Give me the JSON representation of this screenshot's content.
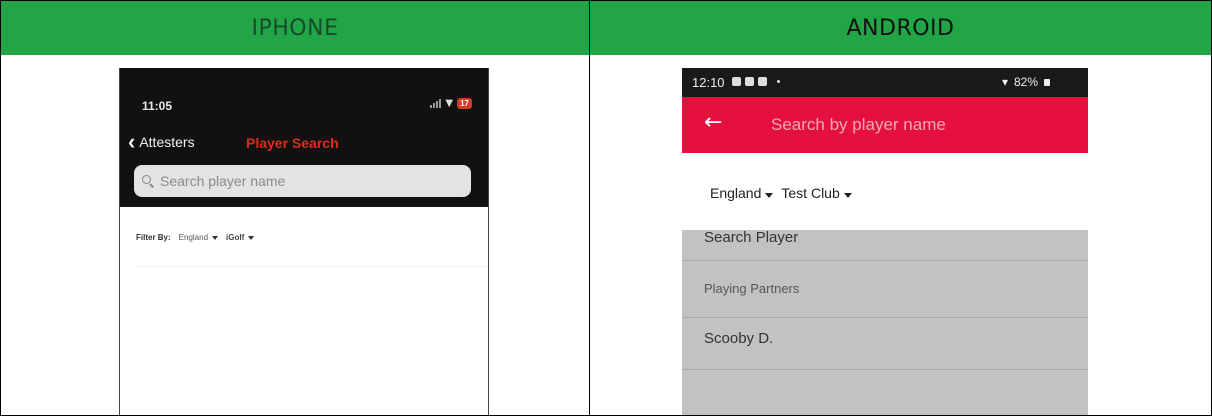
{
  "table": {
    "headers": [
      "IPHONE",
      "ANDROID"
    ]
  },
  "iphone": {
    "status_time": "11:05",
    "battery": "17",
    "back_label": "Attesters",
    "title": "Player Search",
    "search_placeholder": "Search player name",
    "filter_label": "Filter By:",
    "filter_country": "England",
    "filter_club": "iGolf"
  },
  "android": {
    "status_time": "12:10",
    "battery": "82%",
    "search_placeholder": "Search by player name",
    "filter_country": "England",
    "filter_club": "Test Club",
    "list": [
      "Search Player",
      "Playing Partners",
      "Scooby D."
    ]
  },
  "colors": {
    "header_green": "#21a546",
    "ios_title_red": "#e02a1c",
    "android_appbar_red": "#e4103d"
  }
}
